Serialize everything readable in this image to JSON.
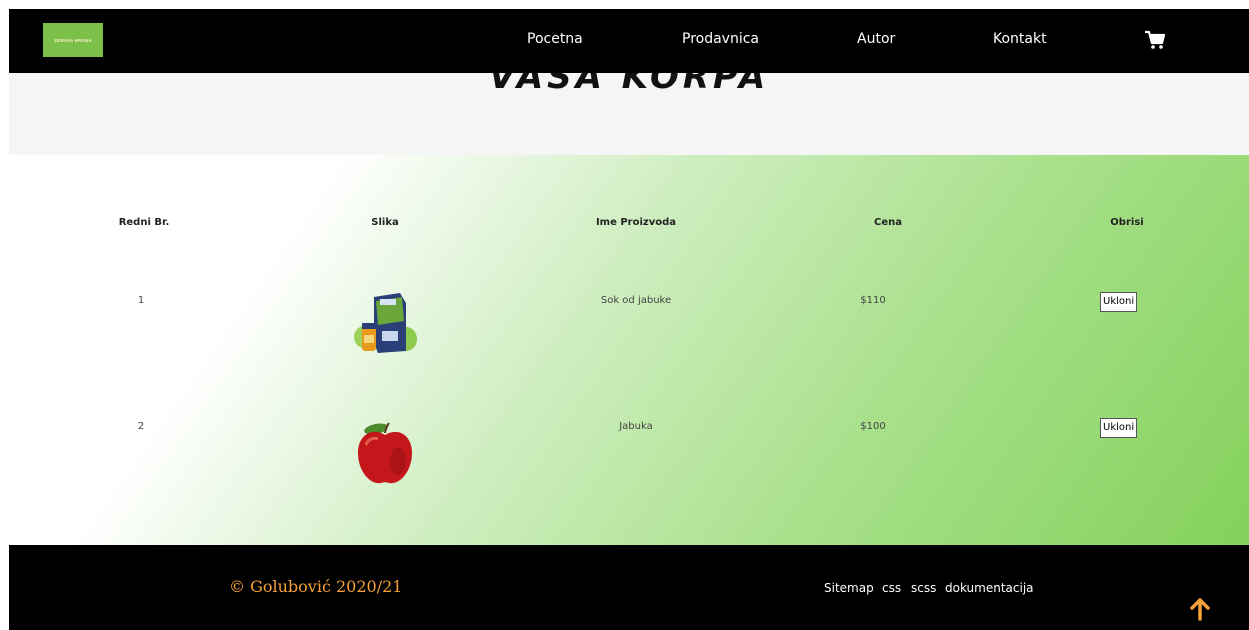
{
  "header": {
    "logo_text": "ZDRAVA HRANA",
    "nav": [
      "Pocetna",
      "Prodavnica",
      "Autor",
      "Kontakt"
    ],
    "cart_icon": "cart-icon"
  },
  "hero": {
    "title": "VASA KORPA"
  },
  "table": {
    "columns": [
      "Redni Br.",
      "Slika",
      "Ime Proizvoda",
      "Cena",
      "Obrisi"
    ],
    "rows": [
      {
        "no": "1",
        "image": "juice-pack-image",
        "name": "Sok od jabuke",
        "price": "$110",
        "action": "Ukloni"
      },
      {
        "no": "2",
        "image": "apple-image",
        "name": "Jabuka",
        "price": "$100",
        "action": "Ukloni"
      }
    ]
  },
  "footer": {
    "copyright": "© Golubović 2020/21",
    "links": [
      "Sitemap",
      "css",
      "scss",
      "dokumentacija"
    ],
    "scroll_top_icon": "arrow-up-icon"
  },
  "colors": {
    "accent": "#f5a13a",
    "brand_green": "#7cc04a"
  }
}
